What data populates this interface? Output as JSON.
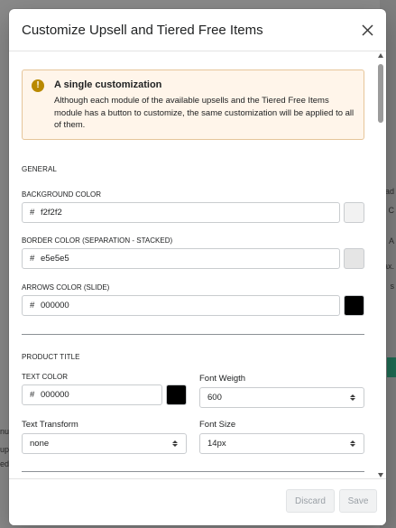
{
  "background": {
    "left_fragments": [
      "nu",
      "up",
      "ed"
    ],
    "right_fragments": [
      "ad",
      "C",
      "A",
      "ax.",
      "s"
    ]
  },
  "modal": {
    "title": "Customize Upsell and Tiered Free Items",
    "banner": {
      "icon": "warning-icon",
      "icon_glyph": "!",
      "title": "A single customization",
      "text": "Although each module of the available upsells and the Tiered Free Items module has a button to customize, the same customization will be applied to all of them."
    },
    "general": {
      "title": "GENERAL",
      "background_color": {
        "label": "BACKGROUND COLOR",
        "hash": "#",
        "value": "f2f2f2",
        "swatch": "#f2f2f2"
      },
      "border_color": {
        "label": "BORDER COLOR (SEPARATION - STACKED)",
        "hash": "#",
        "value": "e5e5e5",
        "swatch": "#e5e5e5"
      },
      "arrows_color": {
        "label": "ARROWS COLOR (SLIDE)",
        "hash": "#",
        "value": "000000",
        "swatch": "#000000"
      }
    },
    "product_title": {
      "title": "PRODUCT TITLE",
      "text_color": {
        "label": "TEXT COLOR",
        "hash": "#",
        "value": "000000",
        "swatch": "#000000"
      },
      "font_weight": {
        "label": "Font Weigth",
        "value": "600"
      },
      "text_transform": {
        "label": "Text Transform",
        "value": "none"
      },
      "font_size": {
        "label": "Font Size",
        "value": "14px"
      }
    },
    "footer": {
      "discard_label": "Discard",
      "save_label": "Save"
    }
  }
}
